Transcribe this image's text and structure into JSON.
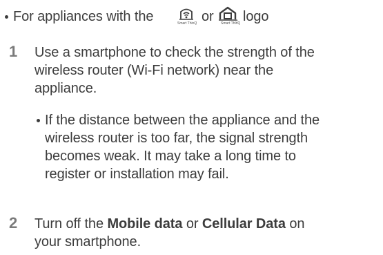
{
  "intro": {
    "text_before": "For appliances with the",
    "text_or": "or",
    "text_after": "logo",
    "logo1_icon": "smartthinq-wifi-logo-icon",
    "logo1_caption": "Smart ThinQ",
    "logo2_icon": "smartthinq-home-logo-icon",
    "logo2_caption": "Smart ThinQ",
    "logo2_mark": "TM"
  },
  "steps": [
    {
      "number": "1",
      "lines": [
        "Use a smartphone to check the strength of the",
        "wireless router (Wi-Fi network) near the",
        "appliance."
      ],
      "sub_bullet_lines": [
        "If the distance between the appliance and the",
        "wireless router is too far, the signal strength",
        "becomes weak. It may take a long time to",
        "register or installation may fail."
      ]
    },
    {
      "number": "2",
      "line1_before": "Turn off the",
      "line1_bold1": "Mobile data",
      "line1_mid": "or",
      "line1_bold2": "Cellular Data",
      "line1_after": "on",
      "line2": "your smartphone."
    }
  ],
  "colors": {
    "text": "#3c3c3c",
    "step_number": "#7a7a7a"
  }
}
